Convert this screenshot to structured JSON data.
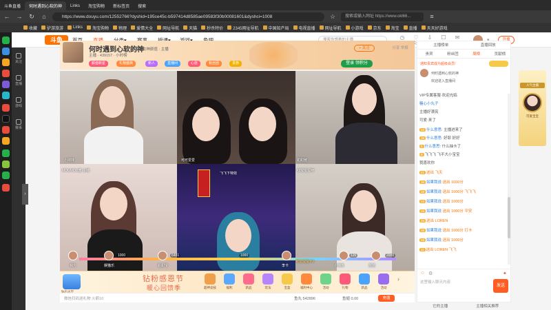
{
  "browser": {
    "tabs": [
      {
        "label": "斗鱼直播"
      },
      {
        "label": "何时遇到心软的神"
      },
      {
        "label": "Links"
      },
      {
        "label": "淘宝购物"
      },
      {
        "label": "新标签页"
      },
      {
        "label": "搜索"
      }
    ],
    "url": "https://www.douyu.com/12552766?dyshid=195ce45c-b597414d8585ae09583f30b00081601&dyshci=1008",
    "search_placeholder": "搜索或输入网址 https://www.okl66..."
  },
  "bookmarks": [
    {
      "label": "收藏"
    },
    {
      "label": "驴游旅游"
    },
    {
      "label": "Links"
    },
    {
      "label": "淘宝购物"
    },
    {
      "label": "物理"
    },
    {
      "label": "爱情大全"
    },
    {
      "label": "网址导航"
    },
    {
      "label": "天猫"
    },
    {
      "label": "秒杀特价"
    },
    {
      "label": "2345网址导航"
    },
    {
      "label": "中国知产局"
    },
    {
      "label": "电视直播"
    },
    {
      "label": "网址导航"
    },
    {
      "label": "小游戏"
    },
    {
      "label": "京东"
    },
    {
      "label": "淘宝"
    },
    {
      "label": "直播"
    },
    {
      "label": "天天好游戏"
    }
  ],
  "site": {
    "logo": "斗鱼",
    "nav": [
      {
        "label": "首页"
      },
      {
        "label": "直播"
      },
      {
        "label": "分类▾"
      },
      {
        "label": "赛事"
      },
      {
        "label": "授课▾"
      },
      {
        "label": "游戏▾"
      },
      {
        "label": "鱼吧"
      }
    ],
    "search_placeholder": "搜索你想看的主播",
    "top_icons": [
      {
        "label": "历史"
      },
      {
        "label": "关注"
      },
      {
        "label": "下载"
      },
      {
        "label": "任务"
      },
      {
        "label": "消息"
      }
    ],
    "open_button": "开播",
    "left_menu": [
      {
        "label": "关注"
      },
      {
        "label": "直播"
      },
      {
        "label": "游戏"
      },
      {
        "label": "赛事"
      }
    ]
  },
  "room": {
    "title": "何时遇到心软的神",
    "meta": "颜值 · 女神颜值 · 主播",
    "meta2": "主播 · 439157 · 小时榜",
    "follow": "+ 关注",
    "share": "分享 举报",
    "login": "登录 领积分",
    "tags": [
      {
        "label": "颜值新星",
        "color": "#ff5a7a"
      },
      {
        "label": "礼物盛典",
        "color": "#ff8a3d"
      },
      {
        "label": "新人",
        "color": "#b86dff"
      },
      {
        "label": "直播间",
        "color": "#4aa3ff"
      },
      {
        "label": "心愿",
        "color": "#ff5a7a"
      },
      {
        "label": "粉丝团",
        "color": "#ff8a3d"
      },
      {
        "label": "贵族",
        "color": "#f2b200"
      }
    ]
  },
  "video": {
    "labels": [
      {
        "text": "小妹妹"
      },
      {
        "text": "可可爱爱"
      },
      {
        "text": "甜甜酱"
      },
      {
        "text": "MOUMOU酱·主播"
      },
      {
        "text": "飞飞下特效"
      },
      {
        "text": "红宝宝星吧"
      },
      {
        "text": "可爱宝宝YO"
      }
    ],
    "bottom_numbers": [
      {
        "text": "1000"
      },
      {
        "text": "6481"
      },
      {
        "text": "1000"
      },
      {
        "text": "126"
      },
      {
        "text": "2000"
      }
    ],
    "bottom_names": [
      {
        "text": "我为"
      },
      {
        "text": "娱猫乐"
      },
      {
        "text": "甜甜宝"
      },
      {
        "text": "李卡"
      },
      {
        "text": "小辣条"
      },
      {
        "text": "苗苗"
      }
    ]
  },
  "giftbar": {
    "banner_line1": "钻粉感恩节",
    "banner_line2": "暖心回馈季",
    "left_label": "钻石大厅",
    "gifts": [
      {
        "label": "超神竞技"
      },
      {
        "label": "福利"
      },
      {
        "label": "新品"
      },
      {
        "label": "玩法"
      },
      {
        "label": "宝盒"
      },
      {
        "label": "福利中心"
      },
      {
        "label": "活动"
      },
      {
        "label": "礼物"
      },
      {
        "label": "新品"
      },
      {
        "label": "活动"
      }
    ],
    "fishball": "鱼丸 542896",
    "balance": "鱼翅 0.00",
    "recharge": "充值",
    "input_placeholder": "微信扫码送礼物 火箭10"
  },
  "sidepanel": {
    "tabs1": [
      {
        "label": "主播榜单"
      },
      {
        "label": "直播回放"
      }
    ],
    "tabs2": [
      {
        "label": "贵宾"
      },
      {
        "label": "粉丝团"
      },
      {
        "label": "周榜"
      },
      {
        "label": "贡献榜"
      }
    ],
    "rank_lines": [
      {
        "text": "通知贵宾成为超级会员!"
      },
      {
        "text": "何时遇到心软的神"
      },
      {
        "text": "欢迎进入直播间"
      }
    ],
    "messages": [
      {
        "nm": "",
        "text": "VIP专属客服·欢迎光临"
      },
      {
        "nm": "糖心小丸子",
        "text": "",
        "lv": ""
      },
      {
        "nm": "",
        "text": "主播好漂亮"
      },
      {
        "nm": "",
        "text": "可爱·来了"
      },
      {
        "nm": "什么意思",
        "text": "主播进来了",
        "lv": "12"
      },
      {
        "nm": "什么意思",
        "text": "好耶 好好",
        "lv": "18"
      },
      {
        "nm": "什么意思",
        "text": "什么抽卡了",
        "lv": "5"
      },
      {
        "nm": "",
        "text": "飞飞飞 飞不大小宝宝",
        "lv": "9"
      },
      {
        "nm": "",
        "text": "我喜欢你",
        "lv": ""
      },
      {
        "nm": "",
        "text": "送出 飞天",
        "lv": "21"
      },
      {
        "nm": "如果我说",
        "text": "送出 1000分",
        "lv": "16",
        "gift": true
      },
      {
        "nm": "如果我说",
        "text": "送出 1000分 飞飞飞",
        "lv": "16",
        "gift": true
      },
      {
        "nm": "如果我说",
        "text": "送出 1000分",
        "lv": "16",
        "gift": true
      },
      {
        "nm": "如果我说",
        "text": "送出 1000分 平安",
        "lv": "16",
        "gift": true
      },
      {
        "nm": "",
        "text": "送出 LOREN",
        "lv": "23"
      },
      {
        "nm": "如果我说",
        "text": "送出 1000分 打卡",
        "lv": "16",
        "gift": true
      },
      {
        "nm": "如果我说",
        "text": "送出 1000分",
        "lv": "16",
        "gift": true
      },
      {
        "nm": "",
        "text": "送出 LOREN 飞飞",
        "lv": "11"
      }
    ],
    "input_placeholder": "这里输入聊天内容",
    "send": "发送",
    "footer": [
      {
        "label": "它的主播"
      },
      {
        "label": "主播相关推荐"
      }
    ]
  },
  "promo": {
    "label": "人气主播",
    "name": "可爱宝宝"
  }
}
